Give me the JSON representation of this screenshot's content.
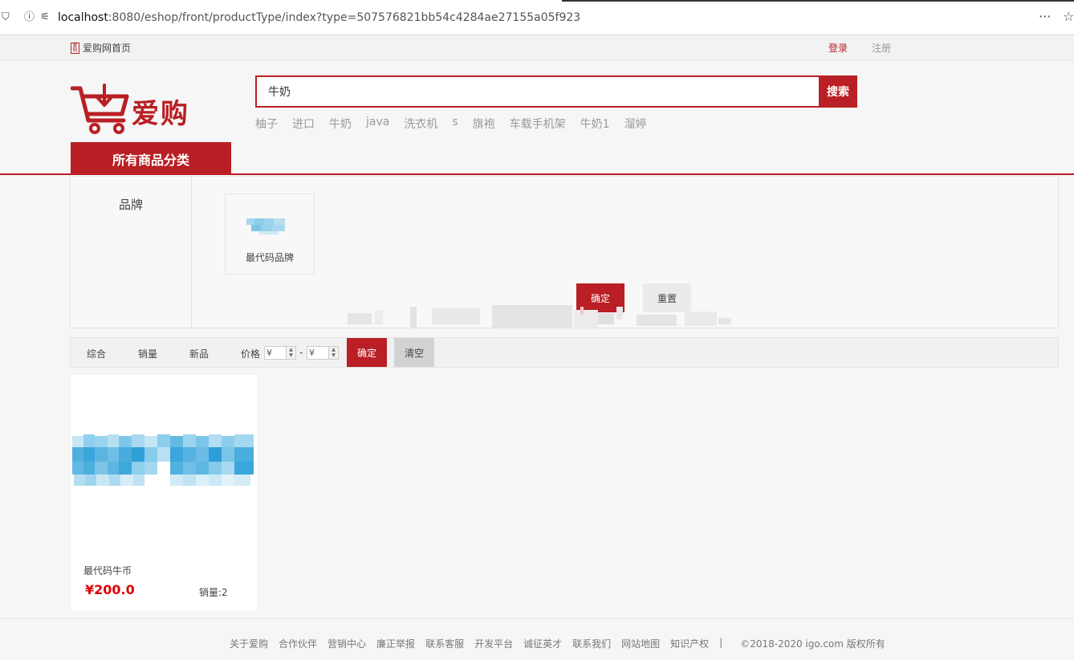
{
  "browser": {
    "url_host": "localhost",
    "url_rest": ":8080/eshop/front/productType/index?type=507576821bb54c4284ae27155a05f923"
  },
  "topbar": {
    "home_label": "爱购网首页",
    "login_label": "登录",
    "register_label": "注册"
  },
  "header": {
    "logo_text": "爱购",
    "search_value": "牛奶",
    "search_button": "搜索",
    "hot_words": [
      "柚子",
      "进口",
      "牛奶",
      "java",
      "洗衣机",
      "s",
      "旗袍",
      "车载手机架",
      "牛奶1",
      "溜婷"
    ],
    "all_categories": "所有商品分类"
  },
  "filter": {
    "label": "品牌",
    "brand_name": "最代码品牌",
    "confirm_button": "确定",
    "reset_button": "重置"
  },
  "sortbar": {
    "items": [
      "综合",
      "销量",
      "新品",
      "价格"
    ],
    "price_min_placeholder": "¥",
    "price_max_placeholder": "¥",
    "dash": "-",
    "confirm_button": "确定",
    "clear_button": "清空"
  },
  "products": [
    {
      "name": "最代码牛币",
      "price": "¥200.0",
      "sales": "销量:2"
    }
  ],
  "footer": {
    "links": [
      "关于爱购",
      "合作伙伴",
      "营销中心",
      "廉正举报",
      "联系客服",
      "开发平台",
      "诚征英才",
      "联系我们",
      "网站地图",
      "知识产权"
    ],
    "separator": "|",
    "copyright": "©2018-2020 igo.com 版权所有"
  },
  "colors": {
    "brand_red": "#b91f24",
    "price_red": "#dd0000"
  }
}
